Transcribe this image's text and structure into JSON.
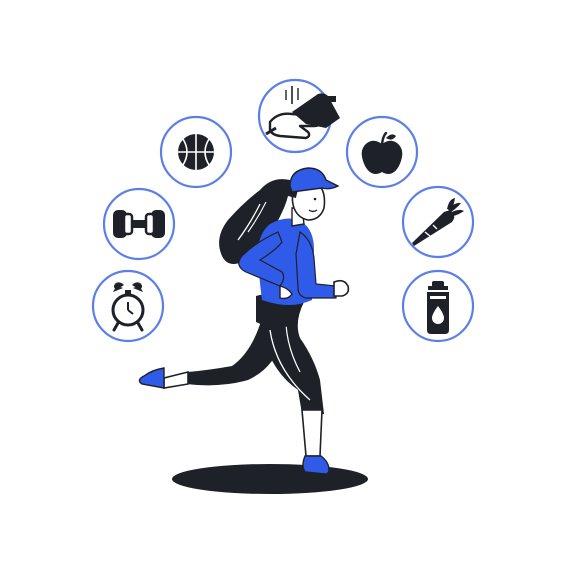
{
  "illustration": {
    "subject": "woman-running",
    "colors": {
      "accent": "#2F5BE8",
      "ink": "#1F2128",
      "ring": "#5B7FE6",
      "skin": "#FFFFFF",
      "background": "#FFFFFF"
    },
    "icons": [
      "alarm-clock-icon",
      "dumbbell-icon",
      "basketball-icon",
      "hand-washing-icon",
      "apple-icon",
      "carrot-icon",
      "water-bottle-icon"
    ]
  }
}
